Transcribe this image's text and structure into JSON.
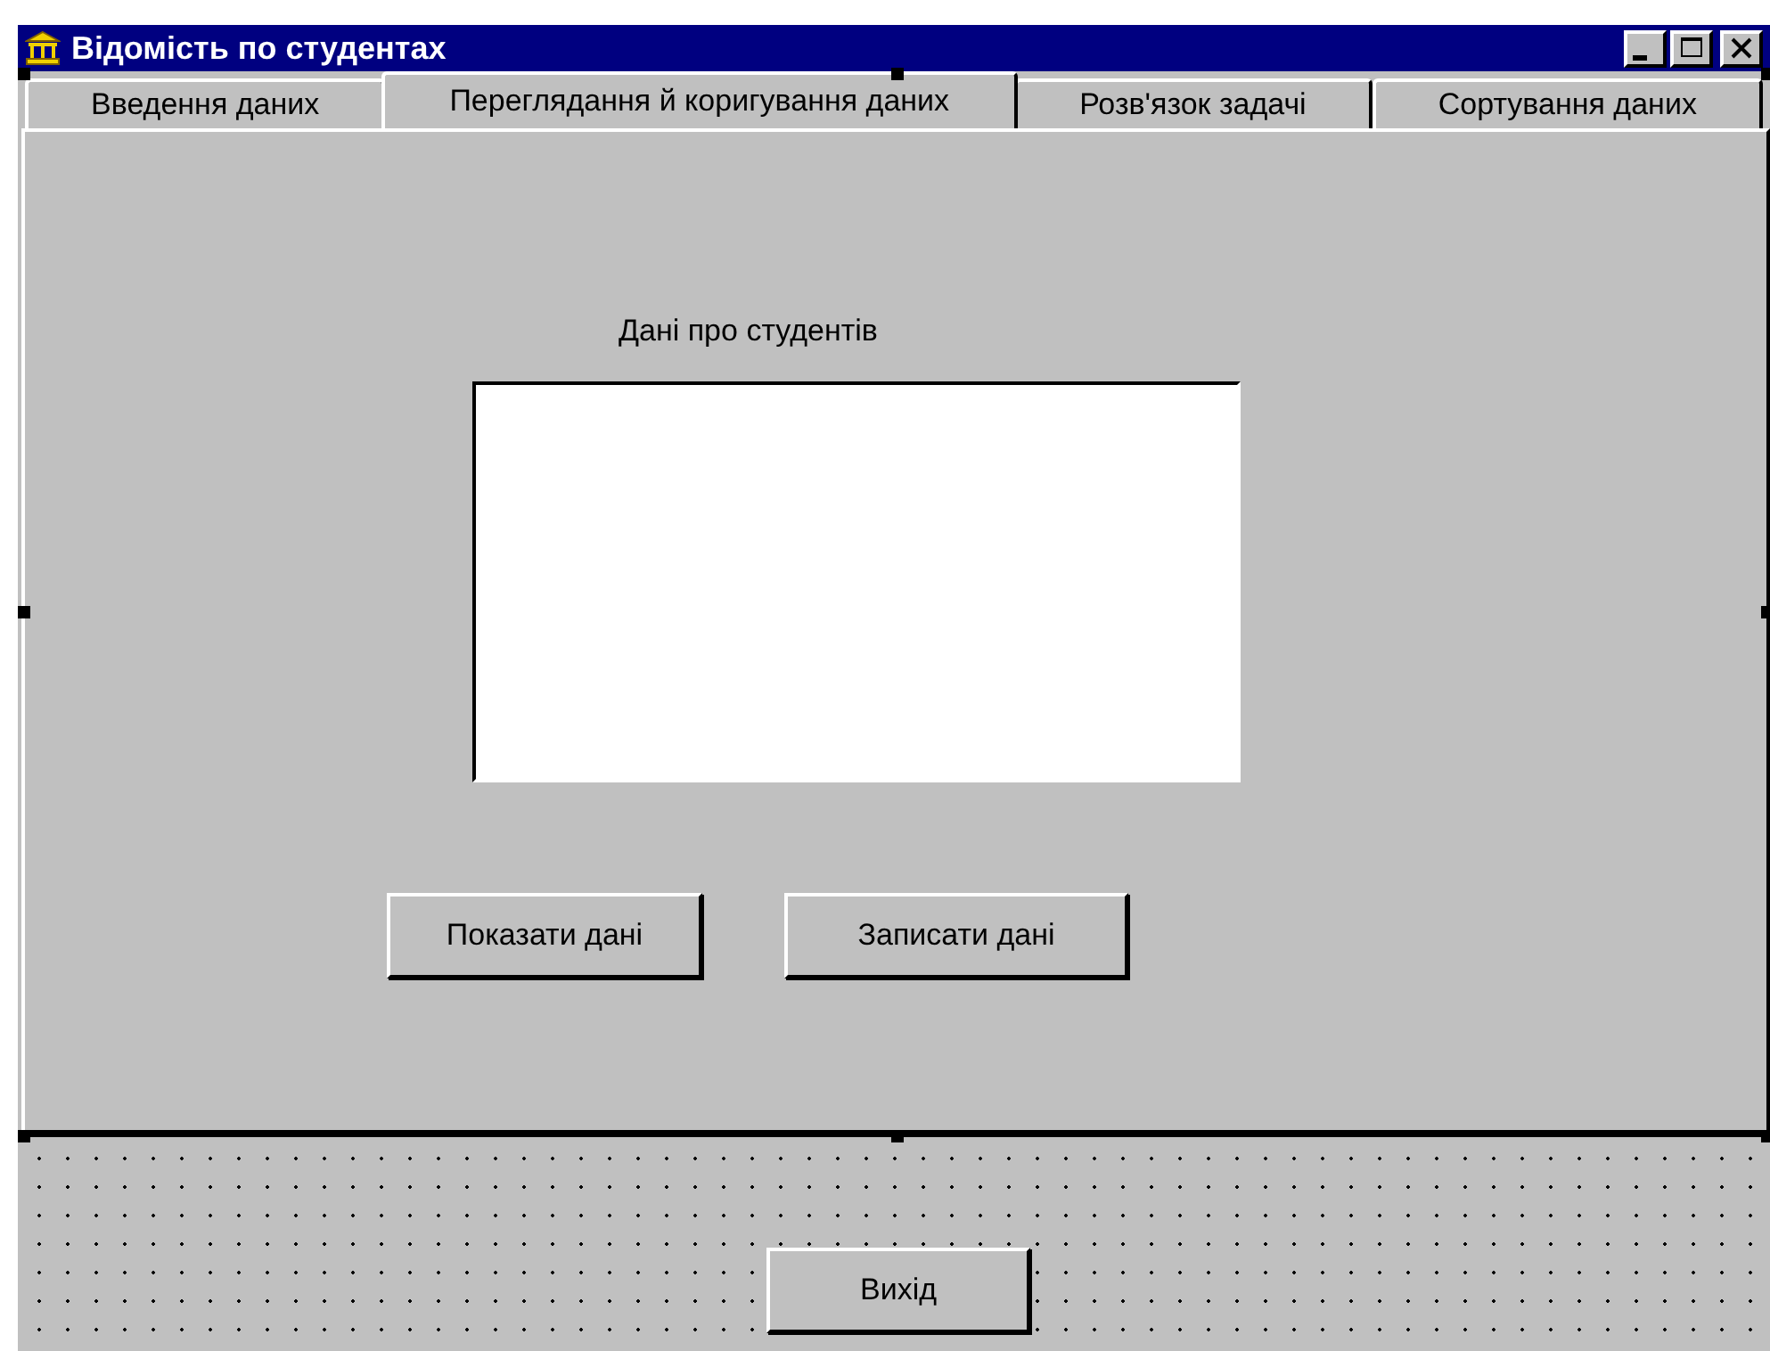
{
  "window": {
    "title": "Відомість по студентах"
  },
  "tabs": [
    {
      "label": "Введення даних",
      "selected": false
    },
    {
      "label": "Переглядання й коригування даних",
      "selected": true
    },
    {
      "label": "Розв'язок задачі",
      "selected": false
    },
    {
      "label": "Сортування даних",
      "selected": false
    }
  ],
  "page": {
    "label": "Дані про студентів",
    "buttons": [
      "Показати дані",
      "Записати дані"
    ]
  },
  "form_buttons": [
    "Вихід"
  ]
}
